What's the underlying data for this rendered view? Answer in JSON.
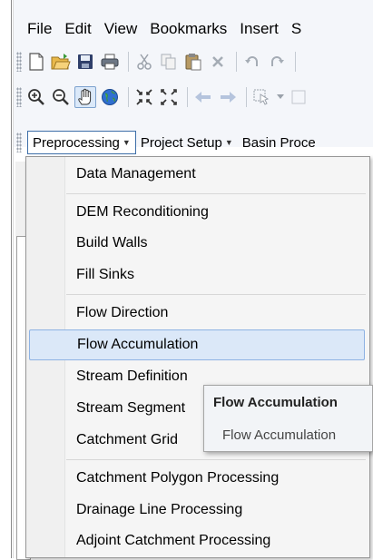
{
  "menubar": {
    "items": [
      "File",
      "Edit",
      "View",
      "Bookmarks",
      "Insert",
      "S"
    ]
  },
  "toolbar1": {
    "icons": [
      "new-document-icon",
      "open-folder-icon",
      "save-icon",
      "print-icon",
      "cut-icon",
      "copy-icon",
      "paste-icon",
      "delete-icon",
      "undo-icon",
      "redo-icon"
    ]
  },
  "toolbar2": {
    "icons": [
      "zoom-in-icon",
      "zoom-out-icon",
      "pan-hand-icon",
      "full-extent-globe-icon",
      "fixed-zoom-in-icon",
      "fixed-zoom-out-icon",
      "back-arrow-icon",
      "forward-arrow-icon",
      "select-features-icon"
    ]
  },
  "archydro_toolbar": {
    "buttons": [
      "Preprocessing",
      "Project Setup",
      "Basin Proce"
    ]
  },
  "dropdown": {
    "items": [
      "Data Management",
      "DEM Reconditioning",
      "Build Walls",
      "Fill Sinks",
      "Flow Direction",
      "Flow Accumulation",
      "Stream Definition",
      "Stream Segment",
      "Catchment Grid",
      "Catchment Polygon Processing",
      "Drainage Line Processing",
      "Adjoint Catchment Processing"
    ],
    "highlighted": "Flow Accumulation"
  },
  "tooltip": {
    "title": "Flow Accumulation",
    "body": "Flow Accumulation"
  },
  "colors": {
    "highlight_fill": "#dbe8f8",
    "highlight_border": "#8db2e3",
    "menu_background": "#f5f5f5"
  }
}
